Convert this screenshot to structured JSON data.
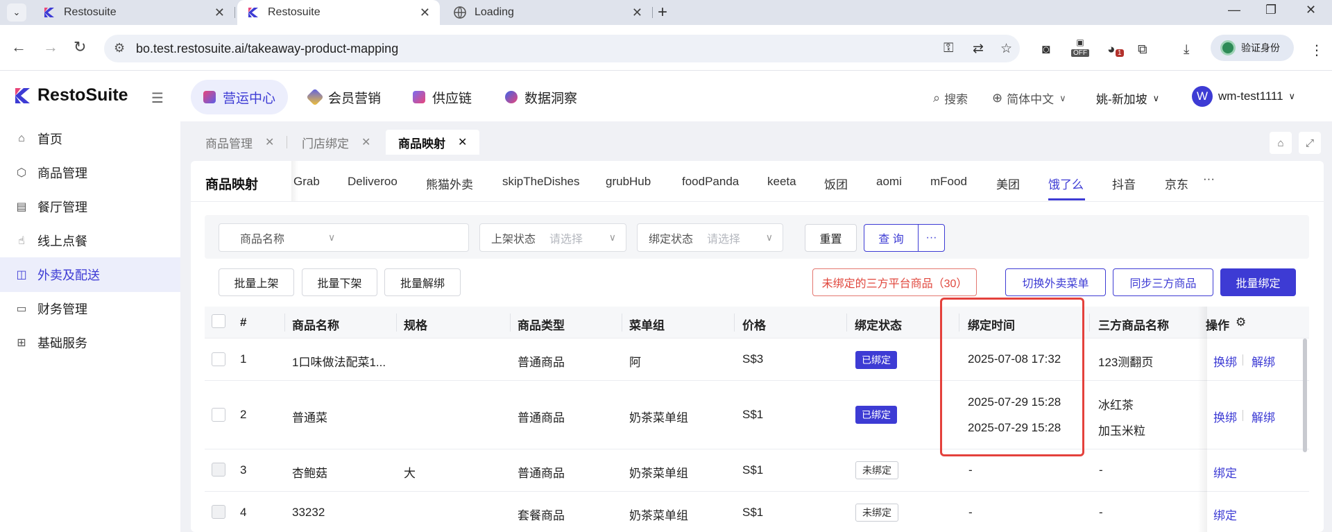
{
  "browser": {
    "tabs": [
      {
        "title": "Restosuite",
        "active": false
      },
      {
        "title": "Restosuite",
        "active": true
      },
      {
        "title": "Loading",
        "active": false
      }
    ],
    "url": "bo.test.restosuite.ai/takeaway-product-mapping",
    "ext_off_label": "OFF",
    "ext_badge": "1",
    "verify_label": "验证身份"
  },
  "app": {
    "logo": "RestoSuite",
    "topnav": [
      {
        "label": "营运中心",
        "active": true,
        "color": "#e8467a"
      },
      {
        "label": "会员营销",
        "active": false,
        "color": "#5b5fe8"
      },
      {
        "label": "供应链",
        "active": false,
        "color": "#7a6cf0"
      },
      {
        "label": "数据洞察",
        "active": false,
        "color": "#3d63e8"
      }
    ],
    "search_label": "搜索",
    "language_label": "简体中文",
    "store_label": "姚-新加坡",
    "user_initial": "W",
    "user_name": "wm-test1111"
  },
  "sidebar": {
    "items": [
      {
        "label": "首页",
        "icon": "home-icon",
        "active": false
      },
      {
        "label": "商品管理",
        "icon": "box-icon",
        "active": false
      },
      {
        "label": "餐厅管理",
        "icon": "store-icon",
        "active": false
      },
      {
        "label": "线上点餐",
        "icon": "tap-icon",
        "active": false
      },
      {
        "label": "外卖及配送",
        "icon": "bag-icon",
        "active": true
      },
      {
        "label": "财务管理",
        "icon": "folder-icon",
        "active": false
      },
      {
        "label": "基础服务",
        "icon": "grid-icon",
        "active": false
      }
    ]
  },
  "page_tabs": [
    {
      "label": "商品管理",
      "active": false
    },
    {
      "label": "门店绑定",
      "active": false
    },
    {
      "label": "商品映射",
      "active": true
    }
  ],
  "mapping": {
    "title": "商品映射",
    "platforms": [
      "Grab",
      "Deliveroo",
      "熊猫外卖",
      "skipTheDishes",
      "grubHub",
      "foodPanda",
      "keeta",
      "饭团",
      "aomi",
      "mFood",
      "美团",
      "饿了么",
      "抖音",
      "京东"
    ],
    "active_platform": "饿了么",
    "more": "···"
  },
  "filters": {
    "product_name_label": "商品名称",
    "shelf_label": "上架状态",
    "shelf_placeholder": "请选择",
    "bind_label": "绑定状态",
    "bind_placeholder": "请选择",
    "reset": "重置",
    "query": "查 询",
    "more": "···"
  },
  "actions": {
    "batch_on": "批量上架",
    "batch_off": "批量下架",
    "batch_unbind": "批量解绑",
    "unbound_third_party": "未绑定的三方平台商品（30）",
    "switch_menu": "切换外卖菜单",
    "sync_third": "同步三方商品",
    "batch_bind": "批量绑定"
  },
  "table": {
    "columns": [
      "#",
      "商品名称",
      "规格",
      "商品类型",
      "菜单组",
      "价格",
      "绑定状态",
      "绑定时间",
      "三方商品名称",
      "操作"
    ],
    "rows": [
      {
        "no": "1",
        "name": "1口味做法配菜1...",
        "spec": "",
        "type": "普通商品",
        "group": "阿",
        "price": "S$3",
        "status": "已绑定",
        "bound": true,
        "time1": "2025-07-08 17:32",
        "time2": "",
        "third1": "123测翻页",
        "third2": "",
        "op1": "换绑",
        "op2": "解绑"
      },
      {
        "no": "2",
        "name": "普通菜",
        "spec": "",
        "type": "普通商品",
        "group": "奶茶菜单组",
        "price": "S$1",
        "status": "已绑定",
        "bound": true,
        "time1": "2025-07-29 15:28",
        "time2": "2025-07-29 15:28",
        "third1": "冰红茶",
        "third2": "加玉米粒",
        "op1": "换绑",
        "op2": "解绑"
      },
      {
        "no": "3",
        "name": "杏鲍菇",
        "spec": "大",
        "type": "普通商品",
        "group": "奶茶菜单组",
        "price": "S$1",
        "status": "未绑定",
        "bound": false,
        "time1": "-",
        "time2": "",
        "third1": "-",
        "third2": "",
        "op1": "绑定",
        "op2": ""
      },
      {
        "no": "4",
        "name": "33232",
        "spec": "",
        "type": "套餐商品",
        "group": "奶茶菜单组",
        "price": "S$1",
        "status": "未绑定",
        "bound": false,
        "time1": "-",
        "time2": "",
        "third1": "-",
        "third2": "",
        "op1": "绑定",
        "op2": ""
      }
    ]
  },
  "colors": {
    "brand": "#3d3bd4",
    "danger": "#e0473d",
    "highlight_box": "#e4413c"
  }
}
